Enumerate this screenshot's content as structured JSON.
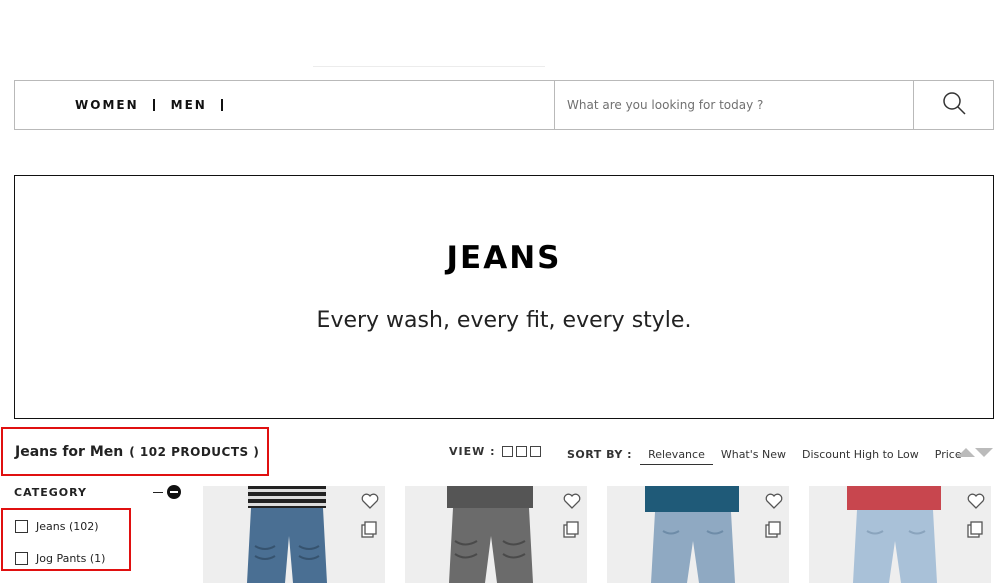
{
  "nav": {
    "links": [
      "WOMEN",
      "MEN"
    ],
    "search_placeholder": "What are you looking for today ?"
  },
  "hero": {
    "title": "JEANS",
    "subtitle": "Every wash, every fit, every style."
  },
  "results": {
    "title": "Jeans for Men",
    "count": "( 102 PRODUCTS )"
  },
  "view": {
    "label": "VIEW :"
  },
  "sort": {
    "label": "SORT BY :",
    "options": [
      "Relevance",
      "What's New",
      "Discount High to Low",
      "Price"
    ],
    "active": "Relevance"
  },
  "filters": {
    "category_title": "CATEGORY",
    "items": [
      "Jeans (102)",
      "Jog Pants (1)"
    ]
  },
  "products": [
    {
      "shirt": "stripes",
      "jeans_color": "#4a6f93",
      "bg": "#eeeeee"
    },
    {
      "shirt": "#555555",
      "jeans_color": "#6b6b6b",
      "bg": "#eeeeee"
    },
    {
      "shirt": "#1f5a78",
      "jeans_color": "#8fa9c2",
      "bg": "#eeeeee"
    },
    {
      "shirt": "#c8464e",
      "jeans_color": "#a9c1d8",
      "bg": "#eeeeee"
    }
  ],
  "icons": {
    "search": "search-icon",
    "heart": "heart-icon",
    "bag": "bag-icon"
  },
  "colors": {
    "highlight": "#e01010",
    "border": "#b9b9b9"
  }
}
